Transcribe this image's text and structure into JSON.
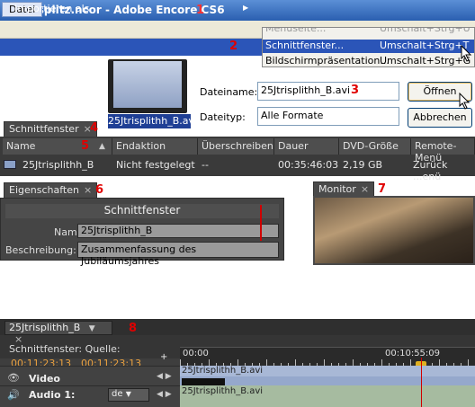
{
  "window": {
    "title": "trisplitz.ncor - Adobe Encore CS6",
    "app_icon": "En"
  },
  "menu": {
    "datei": "Datei",
    "importieren": "Importieren als",
    "flyout": [
      {
        "label": "Menüseite...",
        "shortcut": "Umschalt+Strg+U"
      },
      {
        "label": "Schnittfenster...",
        "shortcut": "Umschalt+Strg+T"
      },
      {
        "label": "Bildschirmpräsentation...",
        "shortcut": "Umschalt+Strg+G"
      }
    ]
  },
  "dialog": {
    "thumb_caption": "25Jtrisplithh_B.avi",
    "filename_label": "Dateiname:",
    "filename_value": "25Jtrisplithh_B.avi",
    "filetype_label": "Dateityp:",
    "filetype_value": "Alle Formate",
    "open": "Öffnen",
    "cancel": "Abbrechen"
  },
  "timelines_panel": {
    "tab": "Schnittfenster",
    "columns": [
      "Name",
      "Endaktion",
      "Überschreiben",
      "Dauer",
      "DVD-Größe",
      "Remote-Menü"
    ],
    "row": [
      "25Jtrisplithh_B",
      "Nicht festgelegt",
      "--",
      "00:35:46:03",
      "2,19 GB",
      "Zurück ...enü"
    ]
  },
  "properties": {
    "tab": "Eigenschaften",
    "header": "Schnittfenster",
    "name_label": "Name:",
    "name_value": "25Jtrisplithh_B",
    "desc_label": "Beschreibung:",
    "desc_value": "Zusammenfassung des Jubiläumsjahres"
  },
  "monitor": {
    "tab": "Monitor"
  },
  "timeline": {
    "tab": "25Jtrisplithh_B",
    "source_label": "Schnittfenster:  Quelle:",
    "tc_timeline": "00:11:23:13",
    "tc_source": "00:11:23:13",
    "ruler_start": "00:00",
    "ruler_mid": "00:10:55:09",
    "video_label": "Video",
    "video_clip": "25Jtrisplithh_B.avi",
    "audio_label": "Audio 1:",
    "audio_lang": "de",
    "audio_clip": "25Jtrisplithh_B.avi"
  },
  "markers": [
    "1",
    "2",
    "3",
    "4",
    "5",
    "6",
    "7",
    "8"
  ]
}
